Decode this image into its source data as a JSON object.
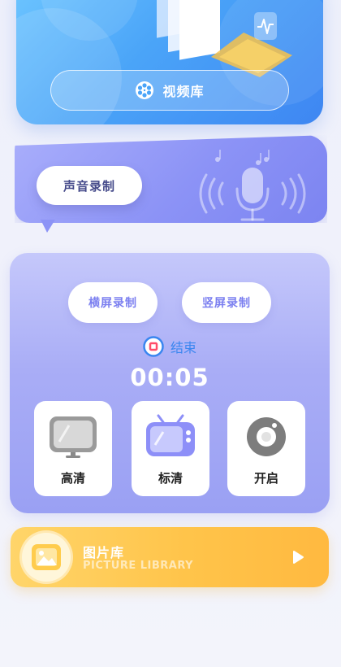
{
  "video_library": {
    "label": "视频库",
    "icon": "film-reel-icon"
  },
  "sound_record": {
    "label": "声音录制",
    "icon": "microphone-icon"
  },
  "record": {
    "landscape_label": "横屏录制",
    "portrait_label": "竖屏录制",
    "stop_label": "结束",
    "timer": "00:05",
    "options": [
      {
        "label": "高清",
        "icon": "monitor-icon"
      },
      {
        "label": "标清",
        "icon": "tv-icon"
      },
      {
        "label": "开启",
        "icon": "record-knob-icon"
      }
    ]
  },
  "picture_library": {
    "title": "图片库",
    "subtitle": "PICTURE LIBRARY",
    "icon": "image-icon"
  },
  "colors": {
    "video_gradient": [
      "#6ec6ff",
      "#3e86f2"
    ],
    "sound_gradient": [
      "#a9aefb",
      "#7c84f1"
    ],
    "panel_gradient": [
      "#c5c8fb",
      "#9aa0f3"
    ],
    "picture_gradient": [
      "#ffd56a",
      "#ffb940"
    ],
    "accent_blue": "#3a86f0",
    "accent_purple": "#7b7ff0",
    "stop_red": "#ff4d6a"
  }
}
